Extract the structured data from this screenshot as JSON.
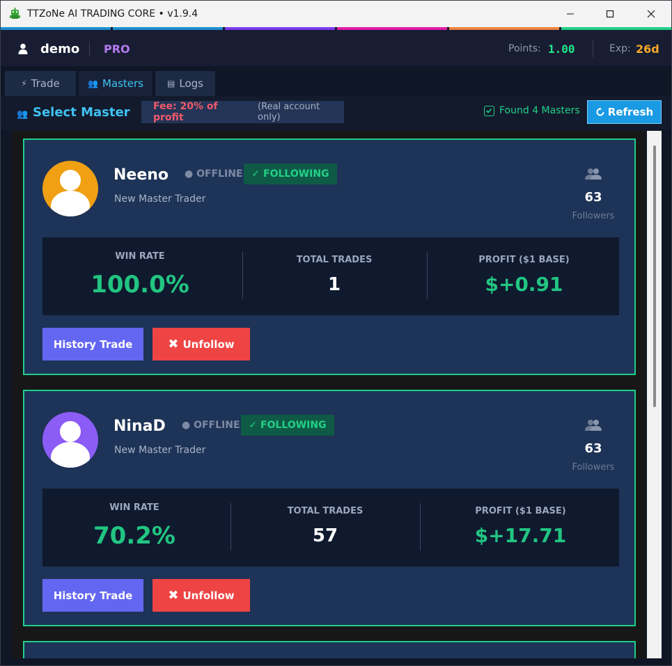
{
  "window": {
    "title": "TTZoNe AI TRADING CORE • v1.9.4",
    "accent_colors": [
      "#1f8fcf",
      "#1f8fcf",
      "#7c3aed",
      "#e11da8",
      "#f08040",
      "#22d087"
    ]
  },
  "userbar": {
    "username": "demo",
    "plan": "PRO",
    "points_label": "Points:",
    "points_value": "1.00",
    "exp_label": "Exp:",
    "exp_value": "26d"
  },
  "tabs": [
    {
      "label": "Trade",
      "icon": "bolt-icon",
      "active": false
    },
    {
      "label": "Masters",
      "icon": "users-icon",
      "active": true
    },
    {
      "label": "Logs",
      "icon": "log-icon",
      "active": false
    }
  ],
  "section": {
    "title": "Select Master",
    "fee_main": "Fee: 20% of profit",
    "fee_sub": "(Real account only)",
    "found_text": "Found 4 Masters",
    "refresh_label": "Refresh"
  },
  "masters": [
    {
      "name": "Neeno",
      "status": "● OFFLINE",
      "following": "✓ FOLLOWING",
      "subtitle": "New Master Trader",
      "followers": "63",
      "followers_label": "Followers",
      "avatar_color": "#f0a012",
      "win_rate_label": "WIN RATE",
      "win_rate": "100.0%",
      "total_trades_label": "TOTAL TRADES",
      "total_trades": "1",
      "profit_label": "PROFIT ($1 BASE)",
      "profit": "$+0.91",
      "history_label": "History Trade",
      "unfollow_label": "Unfollow"
    },
    {
      "name": "NinaD",
      "status": "● OFFLINE",
      "following": "✓ FOLLOWING",
      "subtitle": "New Master Trader",
      "followers": "63",
      "followers_label": "Followers",
      "avatar_color": "#8b5cf6",
      "win_rate_label": "WIN RATE",
      "win_rate": "70.2%",
      "total_trades_label": "TOTAL TRADES",
      "total_trades": "57",
      "profit_label": "PROFIT ($1 BASE)",
      "profit": "$+17.71",
      "history_label": "History Trade",
      "unfollow_label": "Unfollow"
    }
  ]
}
